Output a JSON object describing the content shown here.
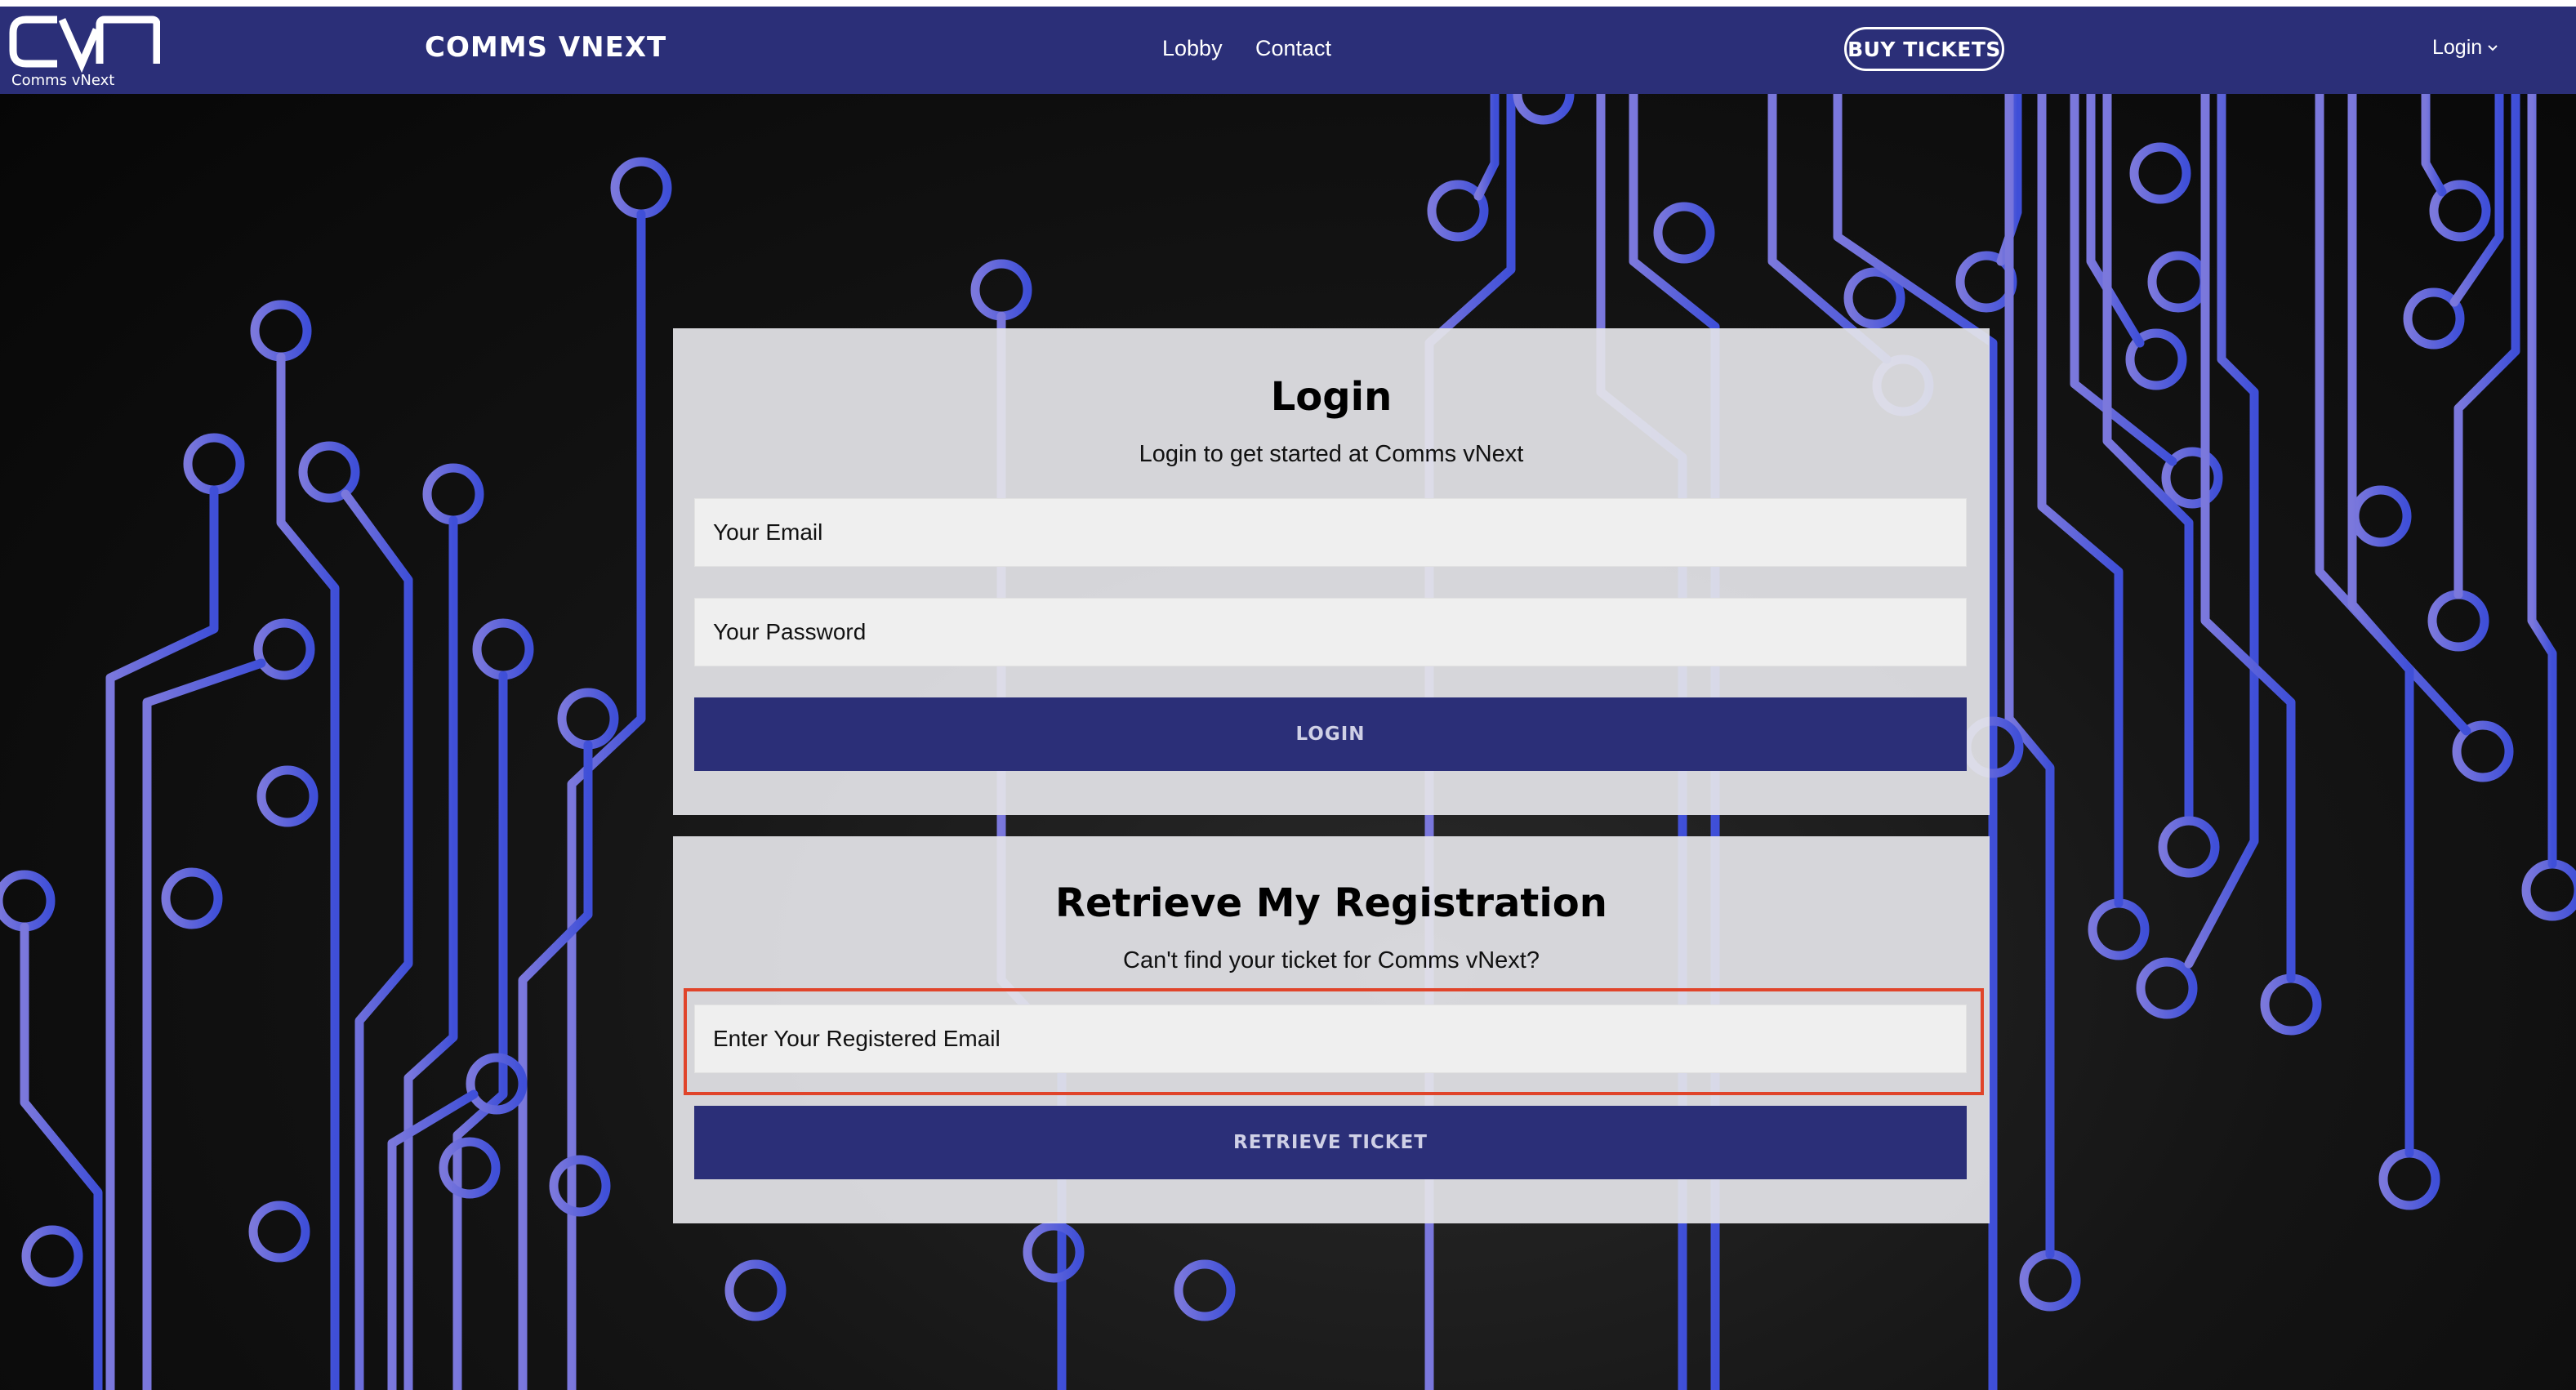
{
  "navbar": {
    "logo_text": "CVN",
    "logo_subtext": "Comms vNext",
    "brand": "COMMS VNEXT",
    "links": [
      {
        "label": "Lobby"
      },
      {
        "label": "Contact"
      }
    ],
    "buy_tickets": "BUY TICKETS",
    "login_menu": "Login",
    "login_menu_icon": "chevron-down-icon"
  },
  "login": {
    "title": "Login",
    "subtitle_prefix": "Login to get started at ",
    "subtitle_event": "Comms vNext",
    "email_placeholder": "Your Email",
    "password_placeholder": "Your Password",
    "button": "LOGIN"
  },
  "retrieve": {
    "title": "Retrieve My Registration",
    "subtitle_prefix": "Can't find your ticket for ",
    "subtitle_event": "Comms vNext?",
    "email_placeholder": "Enter Your Registered Email",
    "button": "RETRIEVE TICKET"
  },
  "colors": {
    "navbar": "#2b2f78",
    "button": "#2b2f78",
    "highlight": "#e0442a",
    "circuit": "#6a6ad8"
  }
}
